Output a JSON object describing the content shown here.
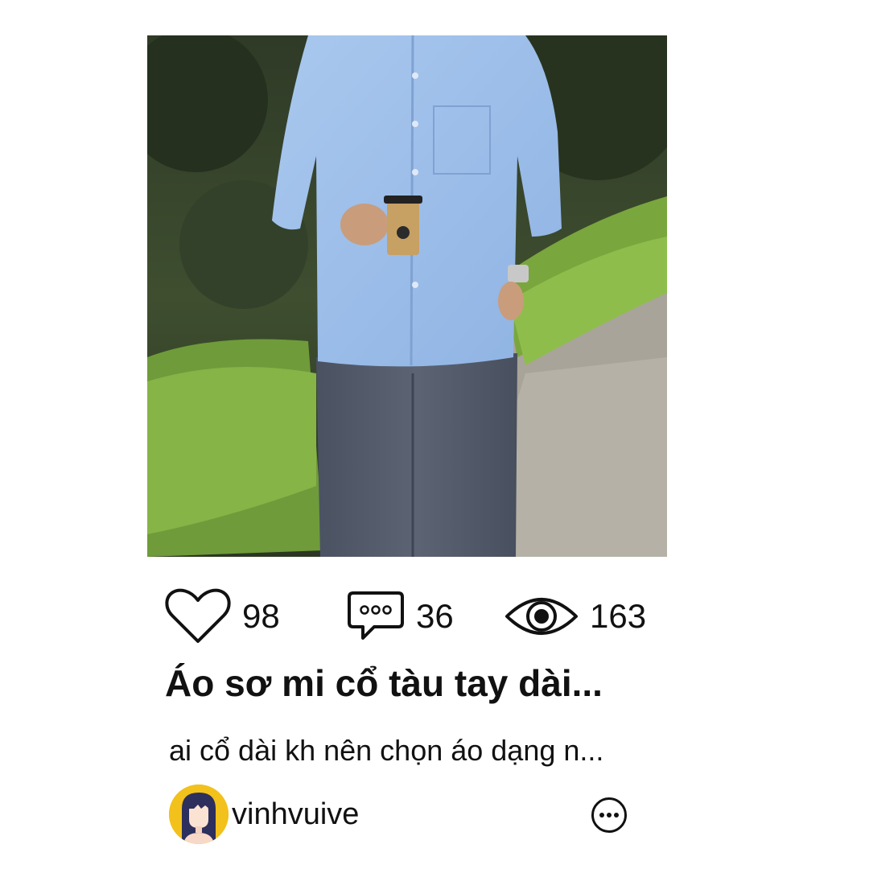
{
  "post": {
    "image_alt": "Man in light blue long-sleeve shirt and grey trousers holding a coffee cup on a garden path",
    "stats": {
      "likes": "98",
      "comments": "36",
      "views": "163"
    },
    "title": "Áo sơ mi cổ tàu tay dài...",
    "excerpt": "ai cổ dài kh nên chọn áo dạng n...",
    "author": {
      "username": "vinhvuive",
      "avatar_icon": "avatar-girl-icon",
      "avatar_color": "#f2c11b"
    },
    "icons": {
      "like": "heart-icon",
      "comment": "speech-bubble-icon",
      "view": "eye-icon",
      "more": "more-options-icon"
    }
  }
}
